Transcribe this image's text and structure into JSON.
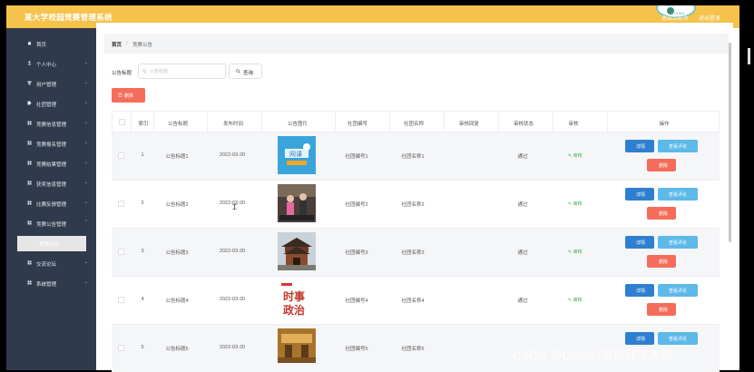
{
  "header": {
    "title": "某大学校园竞赛管理系统",
    "logo_text": "YOUNG",
    "back_label": "退出到前台",
    "logout_label": "退出登录"
  },
  "sidebar": {
    "items": [
      {
        "label": "首页",
        "icon": "home-icon"
      },
      {
        "label": "个人中心",
        "icon": "user-icon"
      },
      {
        "label": "用户管理",
        "icon": "users-icon"
      },
      {
        "label": "社团管理",
        "icon": "tag-icon"
      },
      {
        "label": "竞赛信息管理",
        "icon": "grid-icon"
      },
      {
        "label": "竞赛报名管理",
        "icon": "grid-icon"
      },
      {
        "label": "竞赛结果管理",
        "icon": "grid-icon"
      },
      {
        "label": "获奖信息管理",
        "icon": "grid-icon"
      },
      {
        "label": "比赛反馈管理",
        "icon": "grid-icon"
      },
      {
        "label": "竞赛公告管理",
        "icon": "grid-icon"
      },
      {
        "label": "交流论坛",
        "icon": "grid-icon"
      },
      {
        "label": "系统管理",
        "icon": "grid-icon"
      }
    ],
    "active_sub": "竞赛公告"
  },
  "breadcrumb": {
    "home": "首页",
    "sep": "/",
    "current": "竞赛公告"
  },
  "filter": {
    "label": "公告标题",
    "placeholder": "公告标题",
    "query_label": "查询",
    "delete_label": "删除"
  },
  "table": {
    "columns": [
      "索引",
      "公告标题",
      "发布时间",
      "公告图片",
      "社团编号",
      "社团名称",
      "审核回复",
      "审核状态",
      "审核",
      "操作"
    ],
    "rows": [
      {
        "index": "1",
        "title": "公告标题1",
        "date": "2022-03-20",
        "club_no": "社团编号1",
        "club_name": "社团名称1",
        "reply": "",
        "status": "通过",
        "audit": "审核"
      },
      {
        "index": "2",
        "title": "公告标题2",
        "date": "2022-03-20",
        "club_no": "社团编号2",
        "club_name": "社团名称2",
        "reply": "",
        "status": "通过",
        "audit": "审核"
      },
      {
        "index": "3",
        "title": "公告标题3",
        "date": "2022-03-20",
        "club_no": "社团编号3",
        "club_name": "社团名称3",
        "reply": "",
        "status": "通过",
        "audit": "审核"
      },
      {
        "index": "4",
        "title": "公告标题4",
        "date": "2022-03-20",
        "club_no": "社团编号4",
        "club_name": "社团名称4",
        "reply": "",
        "status": "通过",
        "audit": "审核"
      },
      {
        "index": "5",
        "title": "公告标题5",
        "date": "2022-03-20",
        "club_no": "社团编号5",
        "club_name": "社团名称5",
        "reply": "",
        "status": "",
        "audit": ""
      }
    ],
    "actions": {
      "detail": "详情",
      "review": "查看评论",
      "delete": "删除"
    },
    "thumb_texts": {
      "row1": "网课",
      "row4_top": "时事",
      "row4_bottom": "政治"
    }
  },
  "watermark": "CSDN @Django毕设程序杰哥",
  "colors": {
    "header": "#f5c24c",
    "sidebar": "#2f3a4c",
    "primary": "#2f7fd1",
    "info": "#5db9e8",
    "danger": "#f56c5b",
    "success": "#4caf50"
  }
}
